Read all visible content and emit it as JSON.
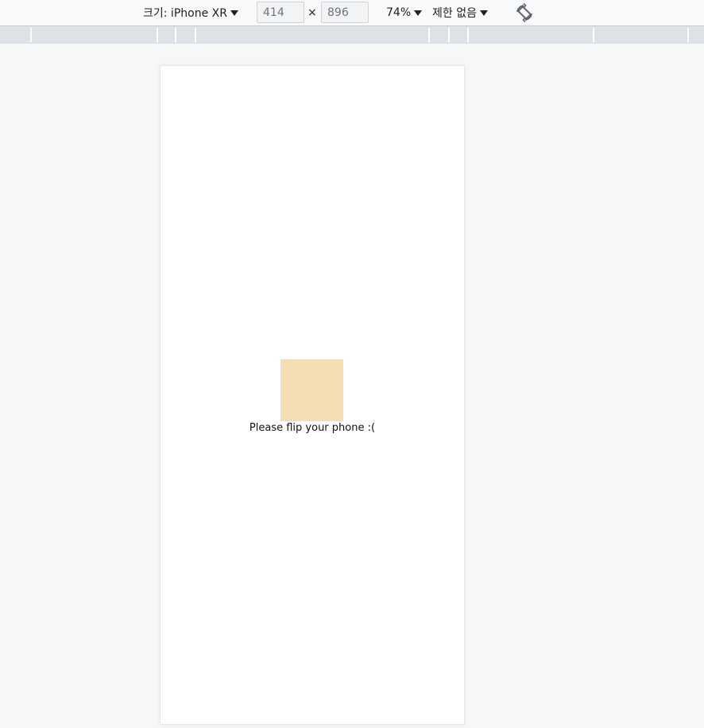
{
  "toolbar": {
    "size_label": "크기: iPhone XR",
    "width_value": "414",
    "times_symbol": "×",
    "height_value": "896",
    "zoom_label": "74%",
    "throttle_label": "제한 없음",
    "rotate_icon": "rotate-icon"
  },
  "viewport": {
    "message": "Please flip your phone :(",
    "square_color": "#f5deb3"
  }
}
